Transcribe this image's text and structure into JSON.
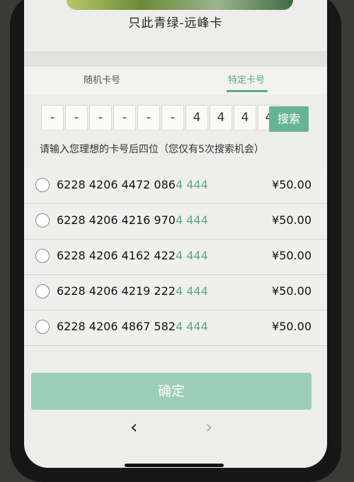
{
  "page_title": "只此青绿-远峰卡",
  "tabs": [
    {
      "label": "随机卡号"
    },
    {
      "label": "特定卡号"
    }
  ],
  "digit_inputs": [
    "-",
    "-",
    "-",
    "-",
    "-",
    "-",
    "4",
    "4",
    "4",
    "4"
  ],
  "search_label": "搜索",
  "hint": "请输入您理想的卡号后四位（您仅有5次搜索机会）",
  "cards": [
    {
      "prefix": "6228 4206 4472 086",
      "suffix": "4 444",
      "price": "¥50.00"
    },
    {
      "prefix": "6228 4206 4216 970",
      "suffix": "4 444",
      "price": "¥50.00"
    },
    {
      "prefix": "6228 4206 4162 422",
      "suffix": "4 444",
      "price": "¥50.00"
    },
    {
      "prefix": "6228 4206 4219 222",
      "suffix": "4 444",
      "price": "¥50.00"
    },
    {
      "prefix": "6228 4206 4867 582",
      "suffix": "4 444",
      "price": "¥50.00"
    }
  ],
  "confirm_label": "确定",
  "nav": {
    "back": "‹",
    "forward": "›"
  },
  "colors": {
    "accent": "#5aa886",
    "button": "#66b495",
    "confirm_bg": "#9ccdb8"
  }
}
